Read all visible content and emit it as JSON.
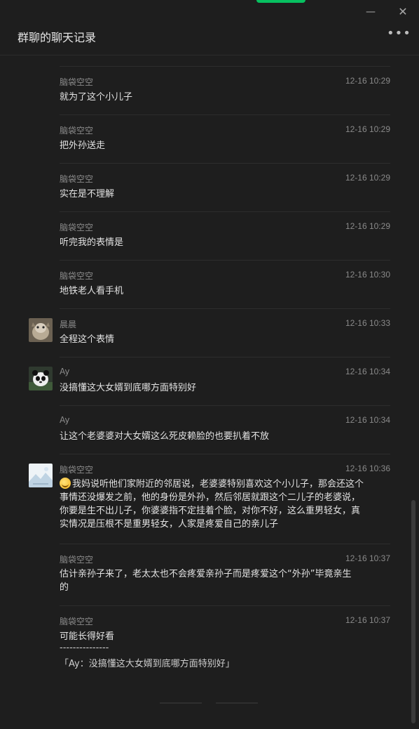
{
  "window": {
    "title": "群聊的聊天记录",
    "minimize_glyph": "—",
    "close_glyph": "✕",
    "more_glyph": "•••"
  },
  "colors": {
    "accent": "#07c160",
    "background": "#1e1e1e"
  },
  "messages": [
    {
      "sender": "脑袋空空",
      "time": "12-16 10:29",
      "text": "就为了这个小儿子",
      "avatar": ""
    },
    {
      "sender": "脑袋空空",
      "time": "12-16 10:29",
      "text": "把外孙送走",
      "avatar": ""
    },
    {
      "sender": "脑袋空空",
      "time": "12-16 10:29",
      "text": "实在是不理解",
      "avatar": ""
    },
    {
      "sender": "脑袋空空",
      "time": "12-16 10:29",
      "text": "听完我的表情是",
      "avatar": ""
    },
    {
      "sender": "脑袋空空",
      "time": "12-16 10:30",
      "text": "地铁老人看手机",
      "avatar": ""
    },
    {
      "sender": "晨晨",
      "time": "12-16 10:33",
      "text": "全程这个表情",
      "avatar": "cat-photo"
    },
    {
      "sender": "Ay",
      "time": "12-16 10:34",
      "text": "没搞懂这大女婿到底哪方面特别好",
      "avatar": "panda-photo"
    },
    {
      "sender": "Ay",
      "time": "12-16 10:34",
      "text": "让这个老婆婆对大女婿这么死皮赖脸的也要扒着不放",
      "avatar": ""
    },
    {
      "sender": "脑袋空空",
      "time": "12-16 10:36",
      "text_line1": "我妈说听他们家附近的邻居说，老婆婆特别喜欢这个小儿子，那会还这个",
      "text_line2": "事情还没爆发之前，他的身份是外孙，然后邻居就跟这个二儿子的老婆说，",
      "text_line3": "你要是生不出儿子，你婆婆指不定挂着个脸，对你不好，这么重男轻女，真",
      "text_line4": "实情况是压根不是重男轻女，人家是疼爱自己的亲儿子",
      "avatar": "landscape-photo",
      "emoji": "laughing-emoji"
    },
    {
      "sender": "脑袋空空",
      "time": "12-16 10:37",
      "text_line1": "估计亲孙子来了，老太太也不会疼爱亲孙子而是疼爱这个“外孙”毕竟亲生",
      "text_line2": "的",
      "avatar": ""
    },
    {
      "sender": "脑袋空空",
      "time": "12-16 10:37",
      "text": "可能长得好看",
      "quote_separator": "---------------",
      "quote": "「Ay：没搞懂这大女婿到底哪方面特别好」",
      "avatar": ""
    }
  ]
}
